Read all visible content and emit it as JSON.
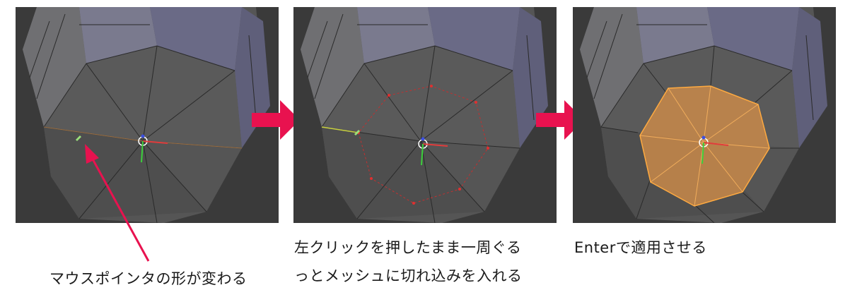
{
  "captions": {
    "step1": "マウスポインタの形が変わる",
    "step2_line1": "左クリックを押したまま一周ぐる",
    "step2_line2": "っとメッシュに切れ込みを入れる",
    "step3": "Enterで適用させる"
  },
  "colors": {
    "viewport_bg": "#3d3d3d",
    "mesh_face": "#595959",
    "mesh_side": "#6e6e73",
    "mesh_top": "#8c8ca3",
    "accent_arrow": "#e8124f",
    "cut_line": "#c23030",
    "selection_fill": "#c98a4a",
    "selection_edge": "#ffaa40",
    "gizmo_x": "#e03c3c",
    "gizmo_y": "#3cd03c",
    "gizmo_z": "#3c50e0"
  },
  "icons": {
    "cursor": "knife-cursor-icon",
    "gizmo": "transform-gizmo-icon",
    "step_arrow": "right-arrow-icon"
  }
}
